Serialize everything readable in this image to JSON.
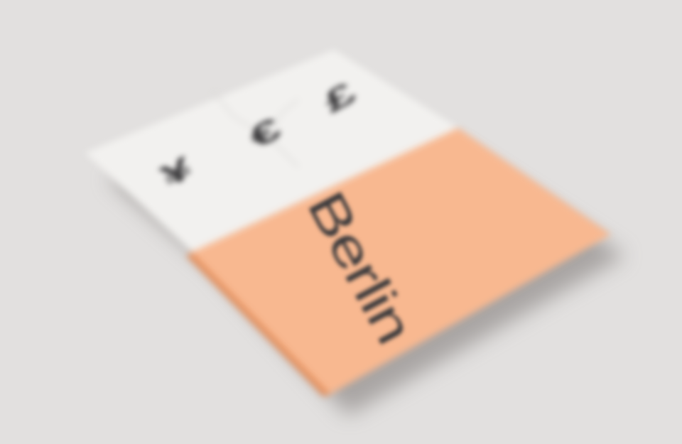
{
  "scene": {
    "background_color": "#e2e0df",
    "poster_top_color": "#f2f1ef",
    "poster_bottom_color": "#f8b890",
    "poster_edge_color": "#e48f5c",
    "ink_color": "#3b3a3c"
  },
  "poster": {
    "symbols": [
      "¥",
      "€",
      "£"
    ],
    "city": "Berlin"
  }
}
